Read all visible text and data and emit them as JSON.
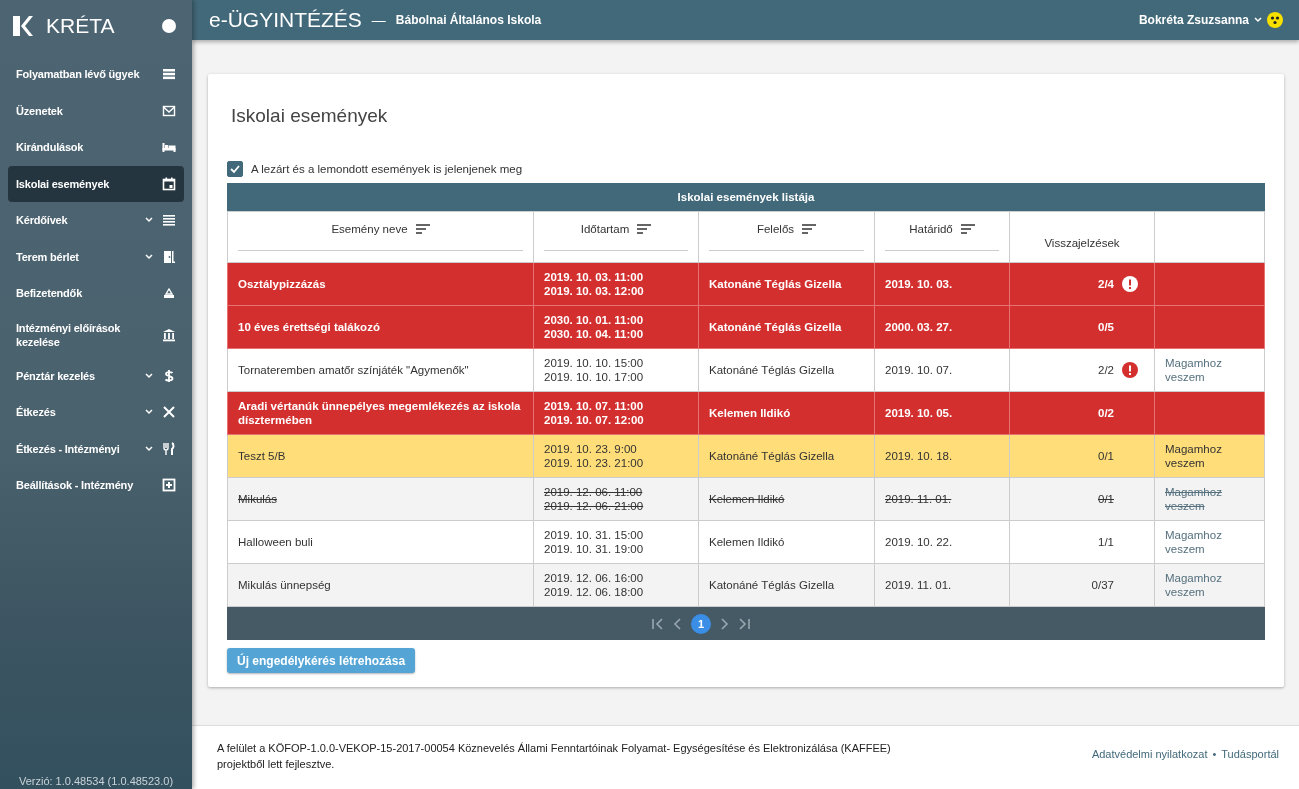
{
  "sidebar": {
    "logo": "KRÉTA",
    "items": [
      {
        "label": "Folyamatban lévő ügyek",
        "expandable": false,
        "selected": false
      },
      {
        "label": "Üzenetek",
        "expandable": false,
        "selected": false
      },
      {
        "label": "Kirándulások",
        "expandable": false,
        "selected": false
      },
      {
        "label": "Iskolai események",
        "expandable": false,
        "selected": true
      },
      {
        "label": "Kérdőívek",
        "expandable": true,
        "selected": false
      },
      {
        "label": "Terem bérlet",
        "expandable": true,
        "selected": false
      },
      {
        "label": "Befizetendők",
        "expandable": false,
        "selected": false
      },
      {
        "label": "Intézményi előírások kezelése",
        "expandable": false,
        "selected": false
      },
      {
        "label": "Pénztár kezelés",
        "expandable": true,
        "selected": false
      },
      {
        "label": "Étkezés",
        "expandable": true,
        "selected": false
      },
      {
        "label": "Étkezés - Intézményi",
        "expandable": true,
        "selected": false
      },
      {
        "label": "Beállítások - Intézmény",
        "expandable": false,
        "selected": false
      }
    ],
    "version": "Verzió: 1.0.48534 (1.0.48523.0)"
  },
  "header": {
    "title": "e-ÜGYINTÉZÉS",
    "dash": "—",
    "school": "Bábolnai Általános Iskola",
    "user": "Bokréta Zsuzsanna"
  },
  "page_title": "Iskolai események",
  "filter": {
    "label": "A lezárt és a lemondott események is jelenjenek meg",
    "checked": true
  },
  "table": {
    "caption": "Iskolai események listája",
    "columns": [
      {
        "label": "Esemény neve",
        "sortable": true
      },
      {
        "label": "Időtartam",
        "sortable": true
      },
      {
        "label": "Felelős",
        "sortable": true
      },
      {
        "label": "Határidő",
        "sortable": true
      },
      {
        "label": "Visszajelzések",
        "sortable": false
      }
    ],
    "rows": [
      {
        "kind": "urgent",
        "name": "Osztálypizzázás",
        "start": "2019. 10. 03. 11:00",
        "end": "2019. 10. 03. 12:00",
        "responsible": "Katonáné Téglás Gizella",
        "deadline": "2019. 10. 03.",
        "feedback": "2/4",
        "alert": true
      },
      {
        "kind": "urgent",
        "name": "10 éves érettségi talákozó",
        "start": "2030. 10. 01. 11:00",
        "end": "2030. 10. 04. 11:00",
        "responsible": "Katonáné Téglás Gizella",
        "deadline": "2000. 03. 27.",
        "feedback": "0/5",
        "alert": false
      },
      {
        "kind": "normal",
        "name": "Tornateremben amatőr színjáték \"Agymenők\"",
        "start": "2019. 10. 10. 15:00",
        "end": "2019. 10. 10. 17:00",
        "responsible": "Katonáné Téglás Gizella",
        "deadline": "2019. 10. 07.",
        "feedback": "2/2",
        "alert": true,
        "action": "Magamhoz veszem"
      },
      {
        "kind": "urgent",
        "name": "Aradi vértanúk ünnepélyes megemlékezés az iskola dísztermében",
        "start": "2019. 10. 07. 11:00",
        "end": "2019. 10. 07. 12:00",
        "responsible": "Kelemen Ildikó",
        "deadline": "2019. 10. 05.",
        "feedback": "0/2",
        "alert": false
      },
      {
        "kind": "highlight",
        "name": "Teszt 5/B",
        "start": "2019. 10. 23. 9:00",
        "end": "2019. 10. 23. 21:00",
        "responsible": "Katonáné Téglás Gizella",
        "deadline": "2019. 10. 18.",
        "feedback": "0/1",
        "alert": false,
        "action": "Magamhoz veszem"
      },
      {
        "kind": "cancelled",
        "name": "Mikulás",
        "start": "2019. 12. 06. 11:00",
        "end": "2019. 12. 06. 21:00",
        "responsible": "Kelemen Ildikó",
        "deadline": "2019. 11. 01.",
        "feedback": "0/1",
        "alert": false,
        "action": "Magamhoz veszem"
      },
      {
        "kind": "normal",
        "name": "Halloween buli",
        "start": "2019. 10. 31. 15:00",
        "end": "2019. 10. 31. 19:00",
        "responsible": "Kelemen Ildikó",
        "deadline": "2019. 10. 22.",
        "feedback": "1/1",
        "alert": false,
        "action": "Magamhoz veszem"
      },
      {
        "kind": "normal",
        "name": "Mikulás ünnepség",
        "start": "2019. 12. 06. 16:00",
        "end": "2019. 12. 06. 18:00",
        "responsible": "Katonáné Téglás Gizella",
        "deadline": "2019. 11. 01.",
        "feedback": "0/37",
        "alert": false,
        "action": "Magamhoz veszem"
      }
    ]
  },
  "pager": {
    "pages": [
      {
        "label": "1",
        "selected": true
      }
    ]
  },
  "new_button": "Új engedélykérés létrehozása",
  "footer": {
    "text": "A felület a KÖFOP-1.0.0-VEKOP-15-2017-00054 Köznevelés Állami Fenntartóinak Folyamat- Egységesítése és Elektronizálása (KAFFEE) projektből lett fejlesztve.",
    "links": [
      "Adatvédelmi nyilatkozat",
      "Tudásportál"
    ],
    "separator": "•"
  }
}
